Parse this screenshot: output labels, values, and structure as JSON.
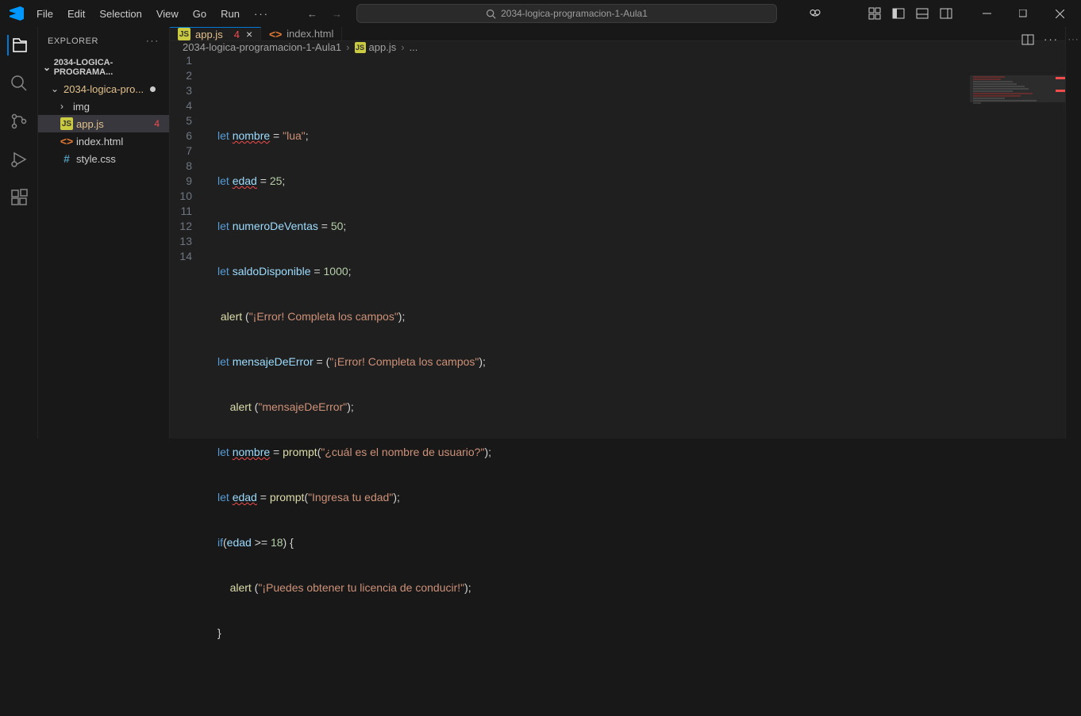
{
  "menu": {
    "file": "File",
    "edit": "Edit",
    "selection": "Selection",
    "view": "View",
    "go": "Go",
    "run": "Run"
  },
  "search_text": "2034-logica-programacion-1-Aula1",
  "explorer_label": "EXPLORER",
  "folder_root": "2034-LOGICA-PROGRAMA...",
  "folder_sub": "2034-logica-pro...",
  "tree": {
    "img": "img",
    "appjs": "app.js",
    "appjs_err": "4",
    "indexhtml": "index.html",
    "stylecss": "style.css"
  },
  "tabs": {
    "appjs": "app.js",
    "appjs_err": "4",
    "indexhtml": "index.html"
  },
  "breadcrumb": {
    "a": "2034-logica-programacion-1-Aula1",
    "b": "app.js",
    "c": "..."
  },
  "code": {
    "l1": "",
    "l2a": "let ",
    "l2v": "nombre",
    "l2b": " = ",
    "l2s": "\"lua\"",
    "l2c": ";",
    "l3a": "let ",
    "l3v": "edad",
    "l3b": " = ",
    "l3n": "25",
    "l3c": ";",
    "l4a": "let ",
    "l4v": "numeroDeVentas",
    "l4b": " = ",
    "l4n": "50",
    "l4c": ";",
    "l5a": "let ",
    "l5v": "saldoDisponible",
    "l5b": " = ",
    "l5n": "1000",
    "l5c": ";",
    "l6a": " ",
    "l6f": "alert",
    "l6b": " (",
    "l6s": "\"¡Error! Completa los campos\"",
    "l6c": ");",
    "l7a": "let ",
    "l7v": "mensajeDeError",
    "l7b": " = (",
    "l7s": "\"¡Error! Completa los campos\"",
    "l7c": ");",
    "l8a": "    ",
    "l8f": "alert",
    "l8b": " (",
    "l8s": "\"mensajeDeError\"",
    "l8c": ");",
    "l9a": "let ",
    "l9v": "nombre",
    "l9b": " = ",
    "l9f": "prompt",
    "l9c": "(",
    "l9s": "\"¿cuál es el nombre de usuario?\"",
    "l9d": ");",
    "l10a": "let ",
    "l10v": "edad",
    "l10b": " = ",
    "l10f": "prompt",
    "l10c": "(",
    "l10s": "\"Ingresa tu edad\"",
    "l10d": ");",
    "l11a": "if",
    "l11b": "(",
    "l11v": "edad",
    "l11c": " >= ",
    "l11n": "18",
    "l11d": ") {",
    "l12a": "    ",
    "l12f": "alert",
    "l12b": " (",
    "l12s": "\"¡Puedes obtener tu licencia de conducir!\"",
    "l12c": ");",
    "l13": "}",
    "l14": ""
  },
  "line_numbers": [
    "1",
    "2",
    "3",
    "4",
    "5",
    "6",
    "7",
    "8",
    "9",
    "10",
    "11",
    "12",
    "13",
    "14"
  ]
}
